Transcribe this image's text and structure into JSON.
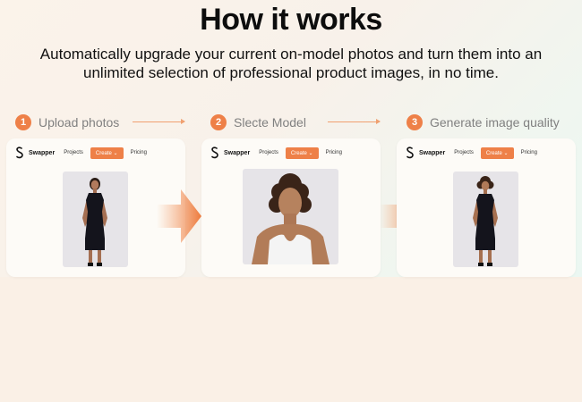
{
  "header": {
    "title": "How it works",
    "subtitle": "Automatically upgrade your current on-model photos and turn them into an unlimited selection of professional product images, in no time."
  },
  "steps": [
    {
      "number": "1",
      "label": "Upload photos"
    },
    {
      "number": "2",
      "label": "Slecte Model"
    },
    {
      "number": "3",
      "label": "Generate image quality"
    }
  ],
  "app_nav": {
    "brand": "Swapper",
    "projects": "Projects",
    "create": "Create ⌄",
    "pricing": "Pricing"
  },
  "colors": {
    "accent": "#ee8048",
    "card": "#fdfbf7",
    "dress": "#14141c",
    "photo_bg": "#e6e4e8"
  },
  "icons": [
    "swapper-logo-icon",
    "arrow-right-icon"
  ]
}
